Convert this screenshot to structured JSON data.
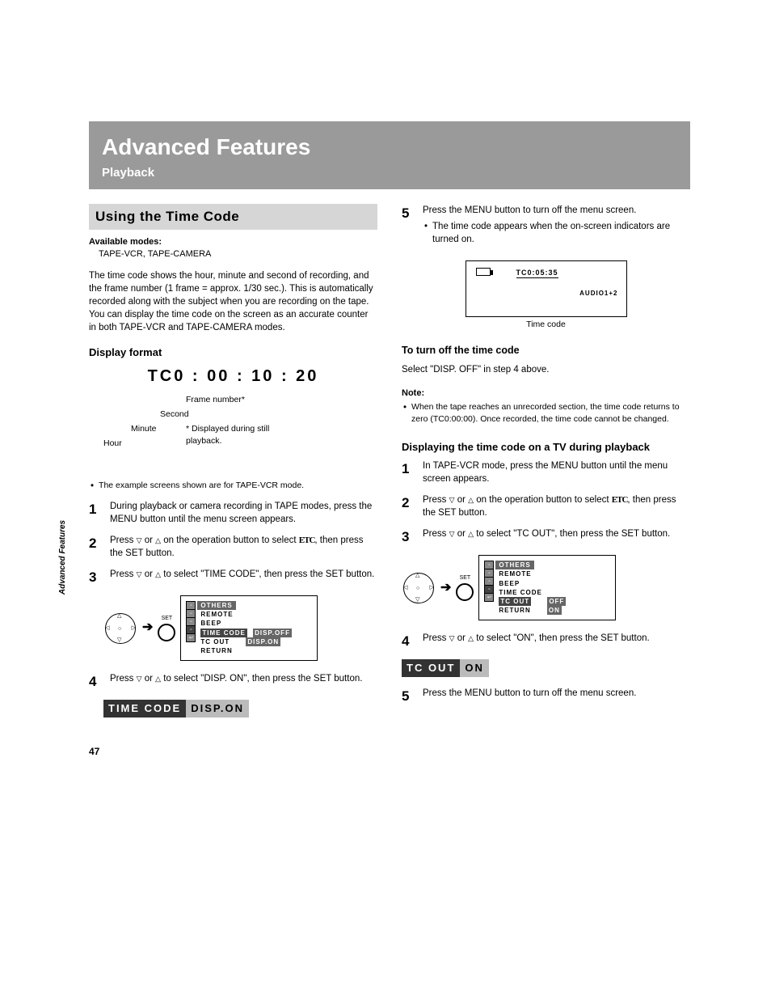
{
  "header": {
    "chapter": "Advanced Features",
    "section": "Playback"
  },
  "side_tab": "Advanced Features",
  "section_title": "Using the Time Code",
  "available": {
    "label": "Available modes:",
    "modes": "TAPE-VCR, TAPE-CAMERA"
  },
  "intro": "The time code shows the hour, minute and second of recording, and the frame number (1 frame = approx. 1/30 sec.). This is automatically recorded along with the subject when you are recording on the tape. You can display the time code on the screen as an accurate counter in both TAPE-VCR and TAPE-CAMERA modes.",
  "display_format": {
    "heading": "Display format",
    "sample": "TC0 : 00 : 10 : 20",
    "labels": {
      "hour": "Hour",
      "minute": "Minute",
      "second": "Second",
      "frame": "Frame number*",
      "footnote": "* Displayed during still playback."
    }
  },
  "example_note": "The example screens shown are for TAPE-VCR mode.",
  "left_steps": {
    "s1": "During playback or camera recording in TAPE modes, press the MENU button until the menu screen appears.",
    "s2a": "Press ",
    "s2b": " or ",
    "s2c": " on the operation button to select ",
    "s2d": ", then press the SET button.",
    "s3a": "Press ",
    "s3b": " or ",
    "s3c": " to select \"TIME CODE\", then press the SET button.",
    "s4a": "Press ",
    "s4b": " or ",
    "s4c": " to select \"DISP. ON\", then press the SET button."
  },
  "osd1": {
    "header": "OTHERS",
    "items": [
      "REMOTE",
      "BEEP",
      "TIME CODE",
      "TC OUT",
      "RETURN"
    ],
    "opt_off": "DISP.OFF",
    "opt_on": "DISP.ON"
  },
  "strip_time": {
    "label": "TIME CODE",
    "value": "DISP.ON"
  },
  "right_steps": {
    "s5a": "Press the MENU button to turn off the menu screen.",
    "s5b": "The time code appears when the on-screen indicators are turned on."
  },
  "screen_demo": {
    "tc": "TC0:05:35",
    "audio": "AUDIO1+2",
    "caption": "Time code"
  },
  "turn_off": {
    "heading": "To turn off the time code",
    "body": "Select \"DISP. OFF\" in step 4 above."
  },
  "note": {
    "label": "Note:",
    "body": "When the tape reaches an unrecorded section, the time code returns to zero (TC0:00:00). Once recorded, the time code cannot be changed."
  },
  "tv_section": {
    "heading": "Displaying the time code on a TV during playback",
    "s1": "In TAPE-VCR mode, press the MENU button until the menu screen appears.",
    "s2a": "Press ",
    "s2b": " or ",
    "s2c": " on the operation button to select ",
    "s2d": ", then press the SET button.",
    "s3a": "Press ",
    "s3b": " or ",
    "s3c": " to select \"TC OUT\", then press the SET button.",
    "s4a": "Press ",
    "s4b": " or ",
    "s4c": " to select \"ON\", then press the SET button.",
    "s5": "Press the MENU button to turn off the menu screen."
  },
  "osd2": {
    "header": "OTHERS",
    "items": [
      "REMOTE",
      "BEEP",
      "TIME CODE",
      "TC OUT",
      "RETURN"
    ],
    "opt_off": "OFF",
    "opt_on": "ON"
  },
  "strip_tcout": {
    "label": "TC OUT",
    "value": "ON"
  },
  "page_number": "47",
  "etc_label": "ETC",
  "set_label": "SET"
}
